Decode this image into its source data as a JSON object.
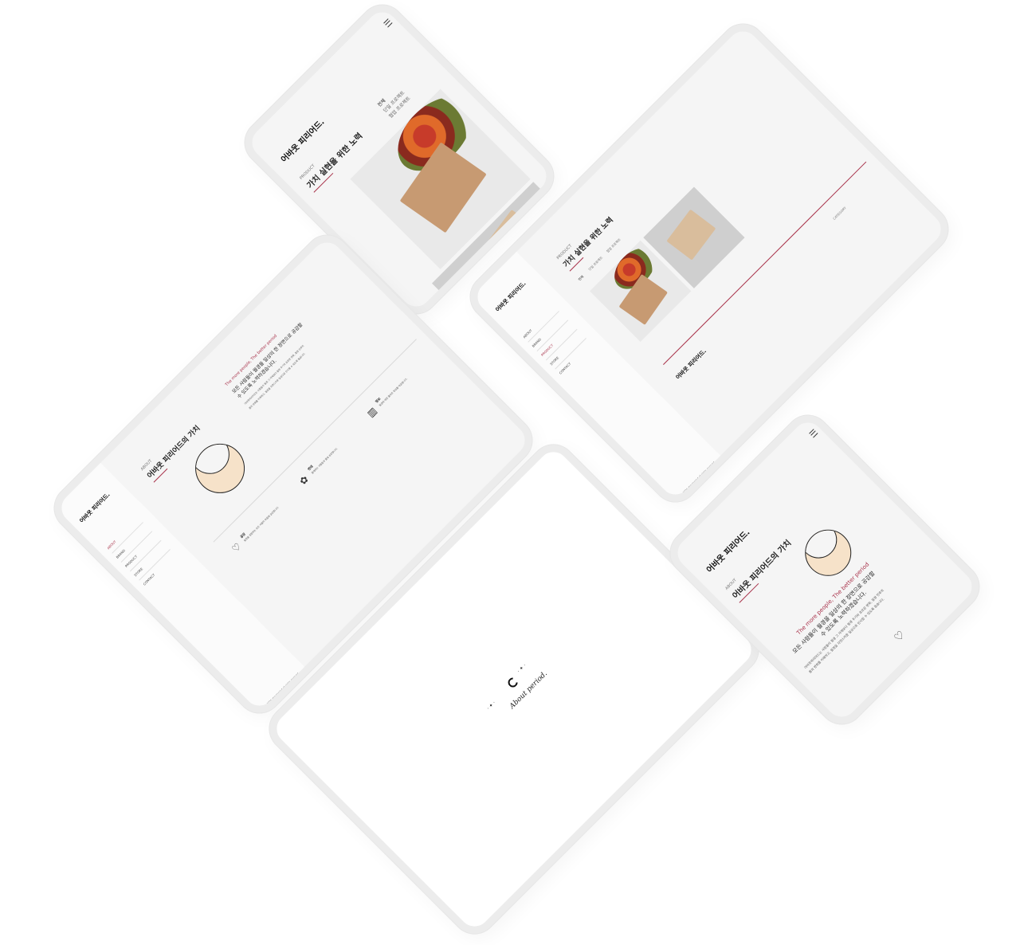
{
  "brand": "어바웃 피리어드.",
  "product_page": {
    "kicker": "PRODUCT",
    "title": "가치 실현을 위한 노력",
    "filters": [
      "전체",
      "단일 프로젝트",
      "협업 프로젝트"
    ],
    "box_logo": "About period."
  },
  "about_page": {
    "kicker": "ABOUT",
    "title": "어바웃 피리어드의 가치",
    "tagline": "The more people, The better period",
    "headline_line1": "모든 사람들이 월경을 일상의 한 장면으로 공감할",
    "headline_line2": "수 있도록 노력하겠습니다.",
    "body1": "어바웃피리어드는 사람들이 월경 그 자체보다 월경 주기와 호르몬 변화, 월경 전후의",
    "body2": "몸의 변화를 이해하고, 월경을 자연스러운 일상으로 인식할 수 있도록 돕습니다.",
    "values": [
      {
        "icon": "heart-icon",
        "label": "공감",
        "desc": "월경을 경험하는 모든 사람의 마음에 공감합니다."
      },
      {
        "icon": "flower-icon",
        "label": "연대",
        "desc": "함께하는 사람들과 함께 성장합니다."
      },
      {
        "icon": "books-icon",
        "label": "정보",
        "desc": "월경에 대한 올바른 정보를 제공합니다."
      }
    ]
  },
  "sidebar_menu": [
    "ABOUT",
    "BRAND",
    "PRODUCT",
    "STORE",
    "CONTACT"
  ],
  "footer": {
    "categories_label": "CATEGORY",
    "copyright": "© 2020 aboutperiod all rights reserved"
  },
  "splash": {
    "logo_text": "About period."
  },
  "colors": {
    "accent": "#a8324a",
    "background": "#f5f5f5",
    "frame": "#ececec",
    "box_kraft": "#c79a72"
  }
}
